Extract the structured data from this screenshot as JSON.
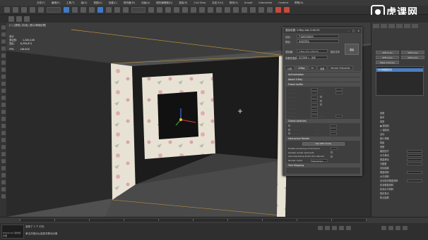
{
  "menubar": {
    "items": [
      "文件(F)",
      "编辑(E)",
      "工具(T)",
      "组(G)",
      "视图(V)",
      "创建(C)",
      "修改器(M)",
      "动画(A)",
      "图形编辑器(D)",
      "渲染(R)",
      "Civil View",
      "自定义(U)",
      "脚本(S)",
      "Arnold",
      "Interactive",
      "Content",
      "帮助(H)"
    ]
  },
  "logo": {
    "text": "虎课网"
  },
  "viewport": {
    "label": "[+] [透视] [标准] [默认明暗处理]",
    "stats": {
      "total_label": "总计",
      "polys_label": "多边形:",
      "polys_value": "1,200,148",
      "verts_label": "顶点:",
      "verts_value": "6,359,671",
      "fps_label": "FPS:",
      "fps_value": "146.818"
    }
  },
  "dialog": {
    "title": "渲染设置: V-Ray Adv 3.60.03",
    "target_label": "目标:",
    "target_value": "产品级渲染模式",
    "preset_label": "预设:",
    "preset_value": "未选定预设",
    "renderer_label": "渲染器:",
    "renderer_value": "V-Ray Adv 3.60.03",
    "save_file_label": "保存文件",
    "view_label": "查看到渲染:",
    "view_value": "四元菜单 4 - 透视",
    "render_button": "渲染",
    "tabs": [
      "公用",
      "V-Ray",
      "GI",
      "设置",
      "Render Elements"
    ],
    "rollout_authorization": "Authorization",
    "rollout_about": "About V-Ray",
    "rollout_frame_buffer": "Frame buffer",
    "rollout_global_switches": "Global switches",
    "interactive_rollout": "Interactive Render",
    "prompt_button": "Use GPU mode",
    "interactive_rows": [
      "Enable rendering of full frame",
      "Update render elements",
      "Use Interactive Production Render"
    ],
    "render_mode_label": "Render mode",
    "render_mode_value": "Interactive",
    "tree_rollout": "Tree Mapping"
  },
  "cmdpanel": {
    "buttons": [
      "VFB Color",
      "VFB Color",
      "VFB Color",
      "VFB Color",
      "Mask Chooser"
    ],
    "list_item": "VR-物理摄影机",
    "params": [
      "参数",
      "基本",
      "类型",
      "● 照相机",
      "○ 摄影机",
      "目标",
      "胶片规格",
      "焦距",
      "视野",
      "缩放因子",
      "水平移动",
      "垂直移动",
      "光圈数",
      "目标距离",
      "垂直倾斜",
      "水平倾斜",
      "自动猜测垂直倾斜",
      "猜测垂直倾斜",
      "猜测水平倾斜",
      "指定焦点",
      "焦点距离"
    ]
  },
  "timeline": {
    "frame": "0 / 100",
    "frame_ticks": [
      "0",
      "10",
      "20",
      "30",
      "40",
      "50",
      "60",
      "70",
      "80",
      "90",
      "100"
    ]
  },
  "statusbar": {
    "left": "选择了 1 个 灯光",
    "prompt": "单击并拖动以选择并移动对象",
    "mini_label": "MAXScript 迷你侦听器"
  },
  "colors": {
    "accent": "#4a7fc1",
    "wall": "#e6e0d2",
    "dark_wall": "#1a1a1a",
    "floor": "#4d4d4d"
  }
}
